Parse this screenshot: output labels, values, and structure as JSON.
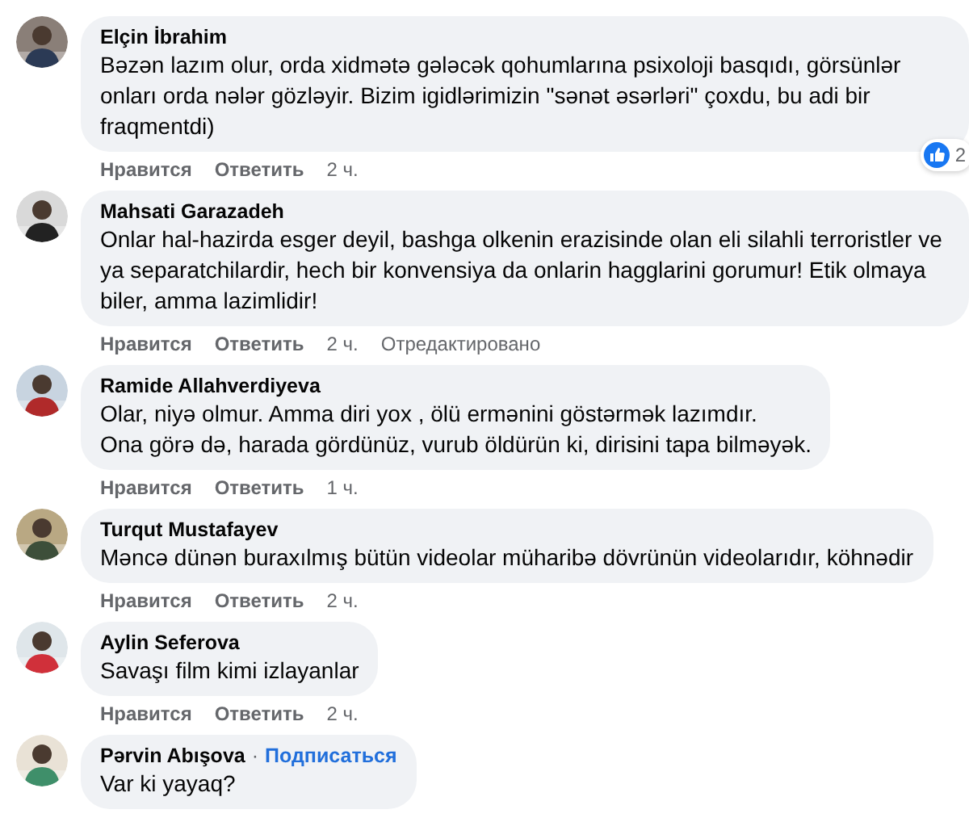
{
  "comments": [
    {
      "author": "Elçin İbrahim",
      "lines": [
        "Bəzən lazım olur, orda xidmətə gələcək qohumlarına psixoloji basqıdı, görsünlər onları orda nələr gözləyir. Bizim igidlərimizin \"sənət əsərləri\" çoxdu, bu adi bir fraqmentdi)"
      ],
      "like": "Нравится",
      "reply": "Ответить",
      "time": "2 ч.",
      "reactions": {
        "count": "2"
      }
    },
    {
      "author": "Mahsati Garazadeh",
      "lines": [
        "Onlar hal-hazirda esger deyil, bashga olkenin erazisinde olan eli silahli terroristler ve ya separatchilardir, hech bir konvensiya da onlarin hagglarini gorumur! Etik olmaya biler, amma lazimlidir!"
      ],
      "like": "Нравится",
      "reply": "Ответить",
      "time": "2 ч.",
      "edited": "Отредактировано"
    },
    {
      "author": "Ramide Allahverdiyeva",
      "lines": [
        "Olar, niyə olmur. Amma diri yox , ölü ermənini göstərmək lazımdır.",
        "Ona görə də, harada gördünüz, vurub öldürün ki, dirisini tapa bilməyək."
      ],
      "like": "Нравится",
      "reply": "Ответить",
      "time": "1 ч."
    },
    {
      "author": "Turqut Mustafayev",
      "lines": [
        "Məncə dünən buraxılmış bütün videolar müharibə dövrünün videolarıdır, köhnədir"
      ],
      "like": "Нравится",
      "reply": "Ответить",
      "time": "2 ч."
    },
    {
      "author": "Aylin Seferova",
      "lines": [
        "Savaşı film kimi izlayanlar"
      ],
      "like": "Нравится",
      "reply": "Ответить",
      "time": "2 ч."
    },
    {
      "author": "Pərvin Abışova",
      "follow": {
        "separator": "·",
        "label": "Подписаться"
      },
      "lines": [
        "Var ki yayaq?"
      ]
    }
  ]
}
